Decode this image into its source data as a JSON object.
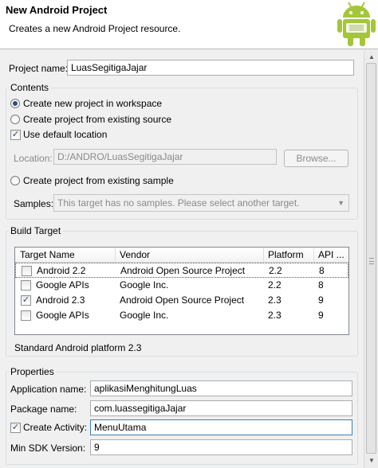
{
  "header": {
    "title": "New Android Project",
    "subtitle": "Creates a new Android Project resource.",
    "logo_icon": "android-robot-icon"
  },
  "project": {
    "name_label": "Project name:",
    "name_value": "LuasSegitigaJajar"
  },
  "contents": {
    "title": "Contents",
    "radio_new": "Create new project in workspace",
    "radio_existing_source": "Create project from existing source",
    "check_default_location": "Use default location",
    "location_label": "Location:",
    "location_value": "D:/ANDRO/LuasSegitigaJajar",
    "browse_label": "Browse...",
    "radio_sample": "Create project from existing sample",
    "samples_label": "Samples:",
    "samples_value": "This target has no samples. Please select another target."
  },
  "build_target": {
    "title": "Build Target",
    "columns": [
      "Target Name",
      "Vendor",
      "Platform",
      "API ..."
    ],
    "rows": [
      {
        "checked": false,
        "name": "Android 2.2",
        "vendor": "Android Open Source Project",
        "platform": "2.2",
        "api": "8"
      },
      {
        "checked": false,
        "name": "Google APIs",
        "vendor": "Google Inc.",
        "platform": "2.2",
        "api": "8"
      },
      {
        "checked": true,
        "name": "Android 2.3",
        "vendor": "Android Open Source Project",
        "platform": "2.3",
        "api": "9"
      },
      {
        "checked": false,
        "name": "Google APIs",
        "vendor": "Google Inc.",
        "platform": "2.3",
        "api": "9"
      }
    ],
    "description": "Standard Android platform 2.3"
  },
  "properties": {
    "title": "Properties",
    "app_name_label": "Application name:",
    "app_name_value": "aplikasiMenghitungLuas",
    "package_label": "Package name:",
    "package_value": "com.luassegitigaJajar",
    "create_activity_label": "Create Activity:",
    "create_activity_value": "MenuUtama",
    "min_sdk_label": "Min SDK Version:",
    "min_sdk_value": "9"
  },
  "colors": {
    "android_green": "#a4c639",
    "group_border": "#d5dfe5",
    "disabled_text": "#8a8a8a"
  }
}
